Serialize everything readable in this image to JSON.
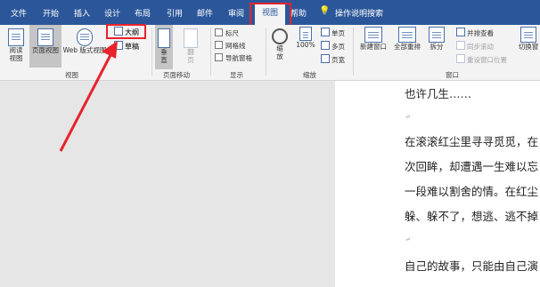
{
  "tabs": [
    "文件",
    "开始",
    "插入",
    "设计",
    "布局",
    "引用",
    "邮件",
    "审阅",
    "视图",
    "帮助",
    "操作说明搜索"
  ],
  "ribbon": {
    "views": {
      "read_mode": [
        "阅读",
        "视图"
      ],
      "print_layout": "页面视图",
      "web_layout": "Web 版式视图",
      "outline": "大纲",
      "draft": "草稿",
      "group_label": "视图"
    },
    "page_move": {
      "vertical": [
        "垂",
        "直"
      ],
      "side_to_side": [
        "翻",
        "页"
      ],
      "group_label": "页面移动"
    },
    "show": {
      "ruler": "标尺",
      "gridlines": "网格线",
      "nav_pane": "导航窗格",
      "group_label": "显示"
    },
    "zoom": {
      "zoom": [
        "缩",
        "放"
      ],
      "hundred": "100%",
      "one_page": "单页",
      "multi_page": "多页",
      "page_width": "页宽",
      "group_label": "缩放"
    },
    "window": {
      "new_window": "新建窗口",
      "arrange_all": "全部重排",
      "split": "拆分",
      "side_by_side": "并排查看",
      "sync_scroll": "同步滚动",
      "reset_position": "重设窗口位置",
      "switch_window": "切换窗",
      "group_label": "窗口"
    }
  },
  "document": {
    "lines": [
      "也许几生……",
      "在滚滚红尘里寻寻觅觅，在",
      "次回眸，却遭遇一生难以忘",
      "一段难以割舍的情。在红尘",
      "躲、躲不了，想逃、逃不掉",
      "自己的故事，只能由自己演"
    ],
    "paragraph_mark": "↵"
  },
  "colors": {
    "accent": "#2b579a",
    "highlight": "#e8232b"
  }
}
